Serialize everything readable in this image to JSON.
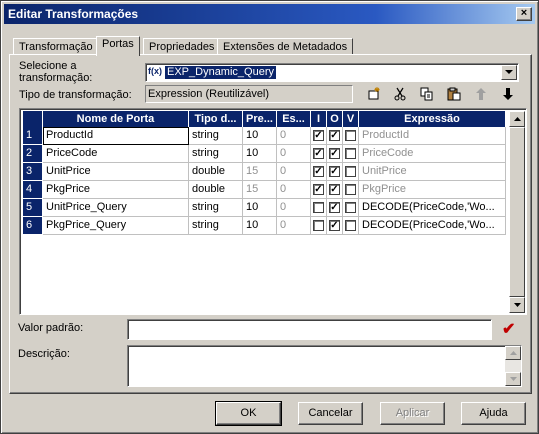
{
  "window": {
    "title": "Editar Transformações",
    "close_glyph": "×"
  },
  "tabs": [
    {
      "label": "Transformação",
      "active": false
    },
    {
      "label": "Portas",
      "active": true
    },
    {
      "label": "Propriedades",
      "active": false
    },
    {
      "label": "Extensões de Metadados",
      "active": false
    }
  ],
  "select_transformation": {
    "label_line1": "Selecione a",
    "label_line2": "transformação:",
    "icon_text": "f(x)",
    "value": "EXP_Dynamic_Query"
  },
  "transformation_type": {
    "label": "Tipo de transformação:",
    "value": "Expression (Reutilizável)"
  },
  "toolbar_icons": [
    "new-port-icon",
    "cut-icon",
    "copy-icon",
    "paste-icon",
    "move-up-icon",
    "move-down-icon"
  ],
  "columns": [
    "Nome de Porta",
    "Tipo d...",
    "Pre...",
    "Es...",
    "I",
    "O",
    "V",
    "Expressão"
  ],
  "rows": [
    {
      "num": "1",
      "name": "ProductId",
      "type": "string",
      "prec": "10",
      "scale": "0",
      "i": true,
      "o": true,
      "v": false,
      "expr": "ProductId",
      "prec_dim": false
    },
    {
      "num": "2",
      "name": "PriceCode",
      "type": "string",
      "prec": "10",
      "scale": "0",
      "i": true,
      "o": true,
      "v": false,
      "expr": "PriceCode",
      "prec_dim": false
    },
    {
      "num": "3",
      "name": "UnitPrice",
      "type": "double",
      "prec": "15",
      "scale": "0",
      "i": true,
      "o": true,
      "v": false,
      "expr": "UnitPrice",
      "prec_dim": true
    },
    {
      "num": "4",
      "name": "PkgPrice",
      "type": "double",
      "prec": "15",
      "scale": "0",
      "i": true,
      "o": true,
      "v": false,
      "expr": "PkgPrice",
      "prec_dim": true
    },
    {
      "num": "5",
      "name": "UnitPrice_Query",
      "type": "string",
      "prec": "10",
      "scale": "0",
      "i": false,
      "o": true,
      "v": false,
      "expr": "DECODE(PriceCode,'Wo...",
      "prec_dim": false
    },
    {
      "num": "6",
      "name": "PkgPrice_Query",
      "type": "string",
      "prec": "10",
      "scale": "0",
      "i": false,
      "o": true,
      "v": false,
      "expr": "DECODE(PriceCode,'Wo...",
      "prec_dim": false
    }
  ],
  "default_value": {
    "label": "Valor padrão:",
    "value": "",
    "validate_glyph": "✔"
  },
  "description": {
    "label": "Descrição:",
    "value": ""
  },
  "buttons": {
    "ok": "OK",
    "cancel": "Cancelar",
    "apply": "Aplicar",
    "help": "Ajuda"
  },
  "colors": {
    "title_bar": "#0a246a",
    "header": "#0a246a",
    "check_red": "#c00000"
  }
}
